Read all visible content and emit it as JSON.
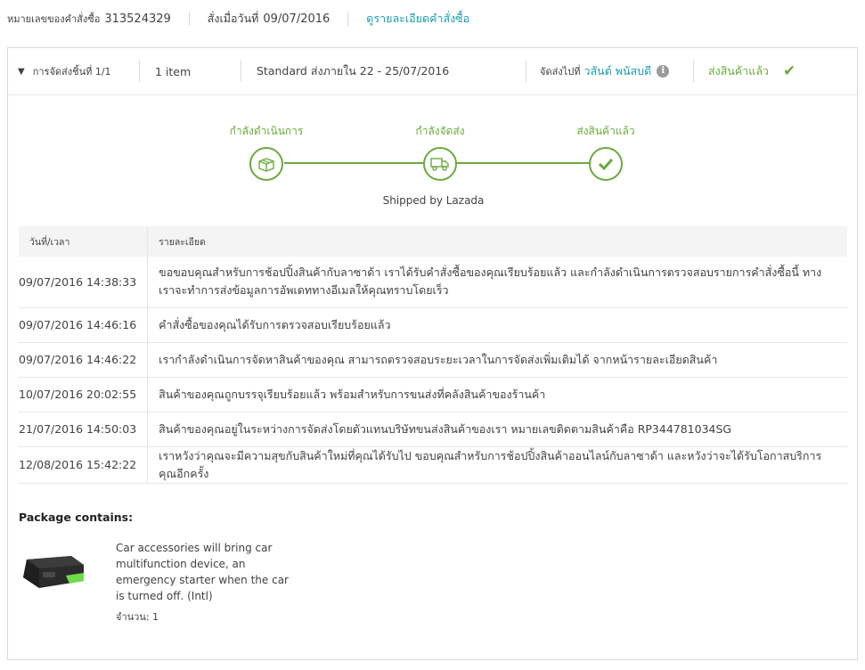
{
  "order": {
    "number_label": "หมายเลขของคำสั่งซื้อ",
    "number": "313524329",
    "ordered_label": "สั่งเมื่อวันที่",
    "ordered_date": "09/07/2016",
    "details_link": "ดูรายละเอียดคำสั่งซื้อ"
  },
  "shipment": {
    "label": "การจัดส่งชิ้นที่ 1/1",
    "items": "1 item",
    "shipping_text": "Standard ส่งภายใน 22 - 25/07/2016",
    "ship_to_label": "จัดส่งไปที่",
    "recipient": "วสันต์ พนัสบดี",
    "status": "ส่งสินค้าแล้ว",
    "accent": "#6aaa3b"
  },
  "progress": {
    "steps": [
      {
        "label": "กำลังดำเนินการ",
        "icon": "box-icon"
      },
      {
        "label": "กำลังจัดส่ง",
        "icon": "truck-icon"
      },
      {
        "label": "ส่งสินค้าแล้ว",
        "icon": "check-icon"
      }
    ],
    "shipped_by": "Shipped by Lazada"
  },
  "tracking": {
    "headers": {
      "datetime": "วันที่/เวลา",
      "details": "รายละเอียด"
    },
    "rows": [
      {
        "datetime": "09/07/2016 14:38:33",
        "details": "ขอขอบคุณสำหรับการช้อปปิ้งสินค้ากับลาซาด้า เราได้รับคำสั่งซื้อของคุณเรียบร้อยแล้ว และกำลังดำเนินการตรวจสอบรายการคำสั่งซื้อนี้ ทางเราจะทำการส่งข้อมูลการอัพเดททางอีเมลให้คุณทราบโดยเร็ว"
      },
      {
        "datetime": "09/07/2016 14:46:16",
        "details": "คำสั่งซื้อของคุณได้รับการตรวจสอบเรียบร้อยแล้ว"
      },
      {
        "datetime": "09/07/2016 14:46:22",
        "details": "เรากำลังดำเนินการจัดหาสินค้าของคุณ สามารถตรวจสอบระยะเวลาในการจัดส่งเพิ่มเติมได้ จากหน้ารายละเอียดสินค้า"
      },
      {
        "datetime": "10/07/2016 20:02:55",
        "details": "สินค้าของคุณถูกบรรจุเรียบร้อยแล้ว พร้อมสำหรับการขนส่งที่คลังสินค้าของร้านค้า"
      },
      {
        "datetime": "21/07/2016 14:50:03",
        "details": "สินค้าของคุณอยู่ในระหว่างการจัดส่งโดยตัวแทนบริษัทขนส่งสินค้าของเรา หมายเลขติดตามสินค้าคือ RP344781034SG"
      },
      {
        "datetime": "12/08/2016 15:42:22",
        "details": "เราหวังว่าคุณจะมีความสุขกับสินค้าใหม่ที่คุณได้รับไป ขอบคุณสำหรับการช้อปปิ้งสินค้าออนไลน์กับลาซาด้า และหวังว่าจะได้รับโอกาสบริการคุณอีกครั้ง"
      }
    ]
  },
  "package": {
    "title": "Package contains:",
    "product_name": "Car accessories will bring car multifunction device, an emergency starter when the car is turned off. (Intl)",
    "quantity": "จำนวน: 1"
  }
}
